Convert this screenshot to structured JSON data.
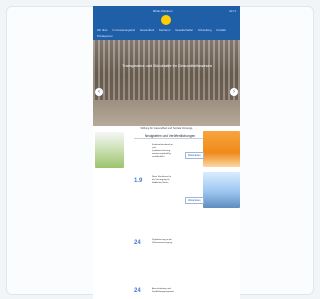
{
  "header": {
    "brand": "Rhön-Klinikum",
    "flag_label": "EN ▾"
  },
  "nav": {
    "items": [
      "Wir über",
      "Im Kostenangebot",
      "Gesundheit",
      "Karrieren",
      "Gesellschafter",
      "Schnellzug",
      "Kontakt",
      "Privatperson"
    ]
  },
  "hero": {
    "title": "Transparenz und Bürokratie im Gesundheitswesen"
  },
  "caption": {
    "text": "Stiftung für Gesundheit und Soziale Fürsorge"
  },
  "section": {
    "title": "Neuigkeiten und Veröffentlichungen"
  },
  "news": [
    {
      "date": "",
      "text": "Krankenhausberichte und Qualitätssicherung werden regelmäßig veröffentlicht",
      "link": "Weiterlesen"
    },
    {
      "date": "1.9",
      "text": "Neue Strukturen für die Versorgung im ländlichen Raum",
      "link": "Weiterlesen"
    },
    {
      "date": "24",
      "text": "Digitalisierung in der Patientenversorgung",
      "link": ""
    },
    {
      "date": "24",
      "text": "Ausschreibung und Fortbildungsprogramm",
      "link": ""
    }
  ],
  "colors": {
    "brand": "#1f5fa8",
    "accent": "#ffcc00",
    "background": "#f1f5f7"
  },
  "icons": {
    "logo": "logo-icon",
    "arrow_left": "chevron-left-icon",
    "arrow_right": "chevron-right-icon"
  }
}
